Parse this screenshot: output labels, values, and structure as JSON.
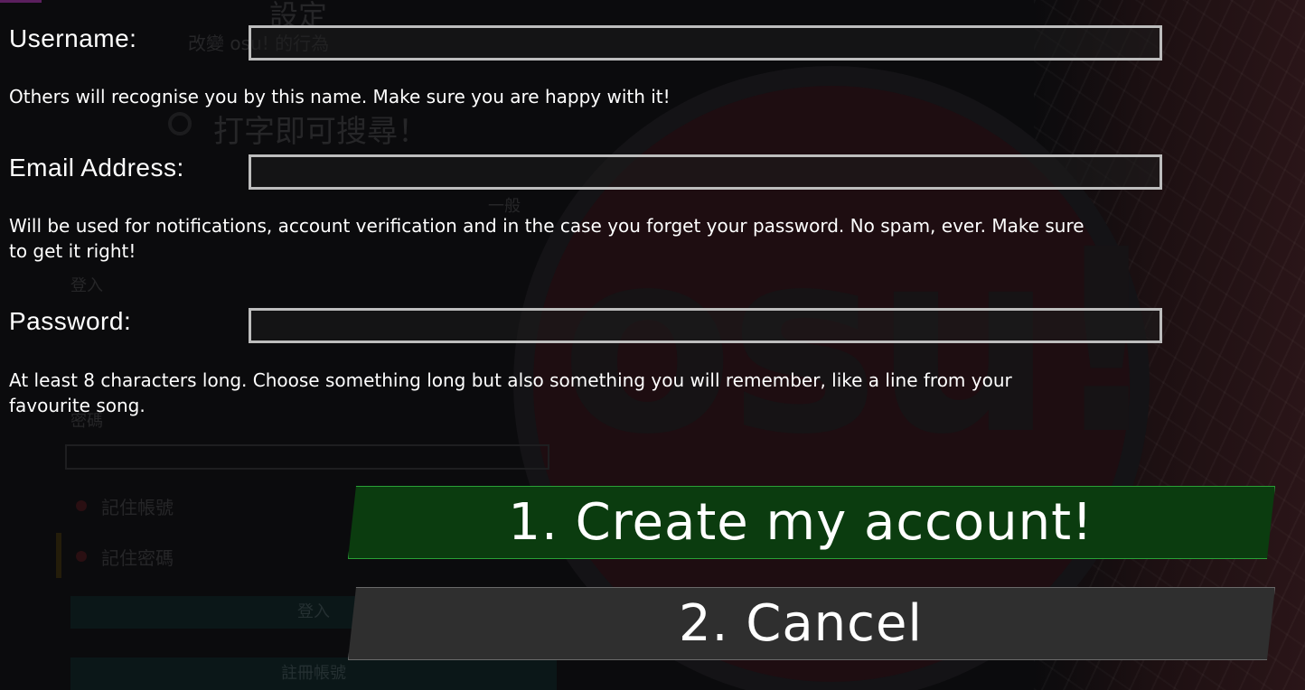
{
  "background": {
    "settings_title": "設定",
    "settings_item": "改變 osu! 的行為",
    "search_hint": "打字即可搜尋！",
    "sub_heading": "一般",
    "section_login": "登入",
    "password_label": "密碼",
    "remember_username": "記住帳號",
    "remember_password": "記住密碼",
    "login_button": "登入",
    "register_button": "註冊帳號",
    "logo_text": "osu!"
  },
  "form": {
    "username": {
      "label": "Username:",
      "value": "",
      "help": "Others will recognise you by this name. Make sure you are happy with it!"
    },
    "email": {
      "label": "Email Address:",
      "value": "",
      "help": "Will be used for notifications, account verification and in the case you forget your password. No spam, ever. Make sure to get it right!"
    },
    "password": {
      "label": "Password:",
      "value": "",
      "help": "At least 8 characters long. Choose something long but also something you will remember, like a line from your favourite song."
    }
  },
  "buttons": {
    "create": "1. Create my account!",
    "cancel": "2. Cancel"
  },
  "colors": {
    "create_bg": "#0b3c0f",
    "create_border": "#2aa137",
    "cancel_bg": "#2f2f2f",
    "input_border": "#bdbdbd"
  }
}
